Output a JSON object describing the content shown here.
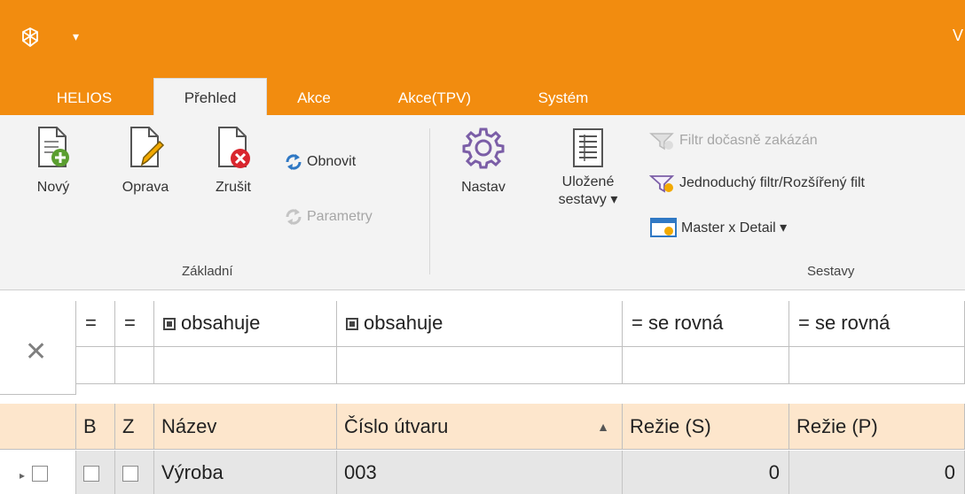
{
  "titlebar": {
    "title_fragment": "V",
    "qa_arrow": "▾"
  },
  "tabs": [
    {
      "label": "HELIOS"
    },
    {
      "label": "Přehled"
    },
    {
      "label": "Akce"
    },
    {
      "label": "Akce(TPV)"
    },
    {
      "label": "Systém"
    }
  ],
  "ribbon": {
    "zakladni": {
      "label": "Základní",
      "buttons": {
        "novy": "Nový",
        "oprava": "Oprava",
        "zrusit": "Zrušit"
      },
      "obnovit": "Obnovit",
      "parametry": "Parametry"
    },
    "sestavy": {
      "label": "Sestavy",
      "nastav": "Nastav",
      "ulozene_line1": "Uložené",
      "ulozene_line2": "sestavy ▾",
      "filtr_zakazan": "Filtr dočasně zakázán",
      "jednoduchy_filtr": "Jednoduchý filtr/Rozšířený filt",
      "master_detail": "Master x Detail ▾"
    }
  },
  "filter_row": {
    "clear": "✕",
    "ops": [
      "=",
      "=",
      "obsahuje",
      "obsahuje",
      "= se rovná",
      "= se rovná"
    ]
  },
  "columns": [
    "B",
    "Z",
    "Název",
    "Číslo útvaru",
    "Režie (S)",
    "Režie (P)"
  ],
  "sort_indicator": "▲",
  "rows": [
    {
      "nazev": "Výroba",
      "cislo": "003",
      "rezie_s": "0",
      "rezie_p": "0"
    }
  ],
  "colors": {
    "accent": "#f28c0f",
    "header_bg": "#fde6cc",
    "row_bg": "#e6e6e6"
  }
}
